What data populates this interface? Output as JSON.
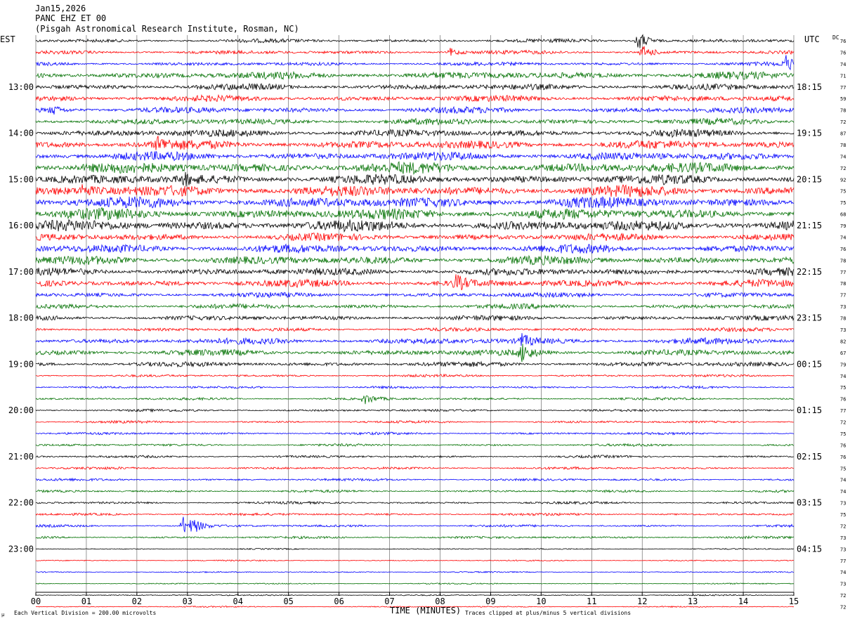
{
  "header": {
    "line1": "Jan15,2026",
    "line2": "PANC EHZ ET 00",
    "line3": "(Pisgah Astronomical Research Institute, Rosman, NC)"
  },
  "left_tz": "EST",
  "right_tz": "UTC",
  "dc_label": "DC",
  "footer": {
    "scale_note": "Each Vertical Division =  200.00 microvolts",
    "clip_note": "Traces clipped at plus/minus 5 vertical divisions",
    "corner_mark": "µ"
  },
  "chart_data": {
    "type": "line",
    "title": "",
    "xlabel": "TIME (MINUTES)",
    "x_ticks": [
      "00",
      "01",
      "02",
      "03",
      "04",
      "05",
      "06",
      "07",
      "08",
      "09",
      "10",
      "11",
      "12",
      "13",
      "14",
      "15"
    ],
    "xlim": [
      0,
      15
    ],
    "grid": true,
    "series_colors": [
      "#000000",
      "#ff0000",
      "#0000ff",
      "#007000"
    ],
    "left_hour_labels": [
      "13:00",
      "14:00",
      "15:00",
      "16:00",
      "17:00",
      "18:00",
      "19:00",
      "20:00",
      "21:00",
      "22:00",
      "23:00"
    ],
    "right_hour_labels": [
      "18:15",
      "19:15",
      "20:15",
      "21:15",
      "22:15",
      "23:15",
      "00:15",
      "01:15",
      "02:15",
      "03:15",
      "04:15"
    ],
    "dc_values": [
      "76",
      "76",
      "74",
      "71",
      "77",
      "59",
      "78",
      "72",
      "87",
      "78",
      "74",
      "72",
      "92",
      "75",
      "75",
      "68",
      "79",
      "74",
      "76",
      "78",
      "77",
      "78",
      "77",
      "73",
      "78",
      "73",
      "82",
      "67",
      "79",
      "74",
      "75",
      "76",
      "77",
      "72",
      "75",
      "76",
      "76",
      "75",
      "74",
      "74",
      "73",
      "75",
      "72",
      "73",
      "73",
      "77",
      "74",
      "73",
      "72",
      "72"
    ],
    "trace_amplitude": [
      3,
      3,
      3,
      6,
      5,
      5,
      5,
      5,
      6,
      7,
      7,
      9,
      8,
      9,
      9,
      9,
      9,
      6,
      7,
      7,
      6,
      6,
      4,
      4,
      4,
      3,
      5,
      5,
      4,
      2,
      2,
      2,
      2,
      2,
      2,
      2,
      2,
      2,
      2,
      2,
      2,
      2,
      2,
      2,
      1,
      1,
      1,
      1,
      1,
      1
    ],
    "events": [
      {
        "trace": 0,
        "minute": 11.9,
        "amp": 16
      },
      {
        "trace": 1,
        "minute": 12.0,
        "amp": 10
      },
      {
        "trace": 1,
        "minute": 8.2,
        "amp": 6
      },
      {
        "trace": 2,
        "minute": 14.8,
        "amp": 14
      },
      {
        "trace": 6,
        "minute": 0.3,
        "amp": 8
      },
      {
        "trace": 9,
        "minute": 2.4,
        "amp": 10
      },
      {
        "trace": 12,
        "minute": 2.9,
        "amp": 8
      },
      {
        "trace": 13,
        "minute": 0.9,
        "amp": 8
      },
      {
        "trace": 21,
        "minute": 8.3,
        "amp": 12
      },
      {
        "trace": 26,
        "minute": 9.6,
        "amp": 10
      },
      {
        "trace": 27,
        "minute": 9.6,
        "amp": 14
      },
      {
        "trace": 31,
        "minute": 6.5,
        "amp": 8
      },
      {
        "trace": 42,
        "minute": 2.9,
        "amp": 14
      },
      {
        "trace": 42,
        "minute": 3.1,
        "amp": 8
      }
    ]
  }
}
